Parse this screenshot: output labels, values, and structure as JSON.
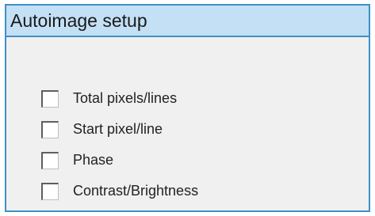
{
  "dialog": {
    "title": "Autoimage setup",
    "options": [
      {
        "label": "Total pixels/lines",
        "checked": false
      },
      {
        "label": "Start pixel/line",
        "checked": false
      },
      {
        "label": "Phase",
        "checked": false
      },
      {
        "label": "Contrast/Brightness",
        "checked": false
      }
    ]
  },
  "colors": {
    "border": "#3f8fc6",
    "title_bar": "#c3e0f5",
    "body_background": "#f0f0f0"
  }
}
